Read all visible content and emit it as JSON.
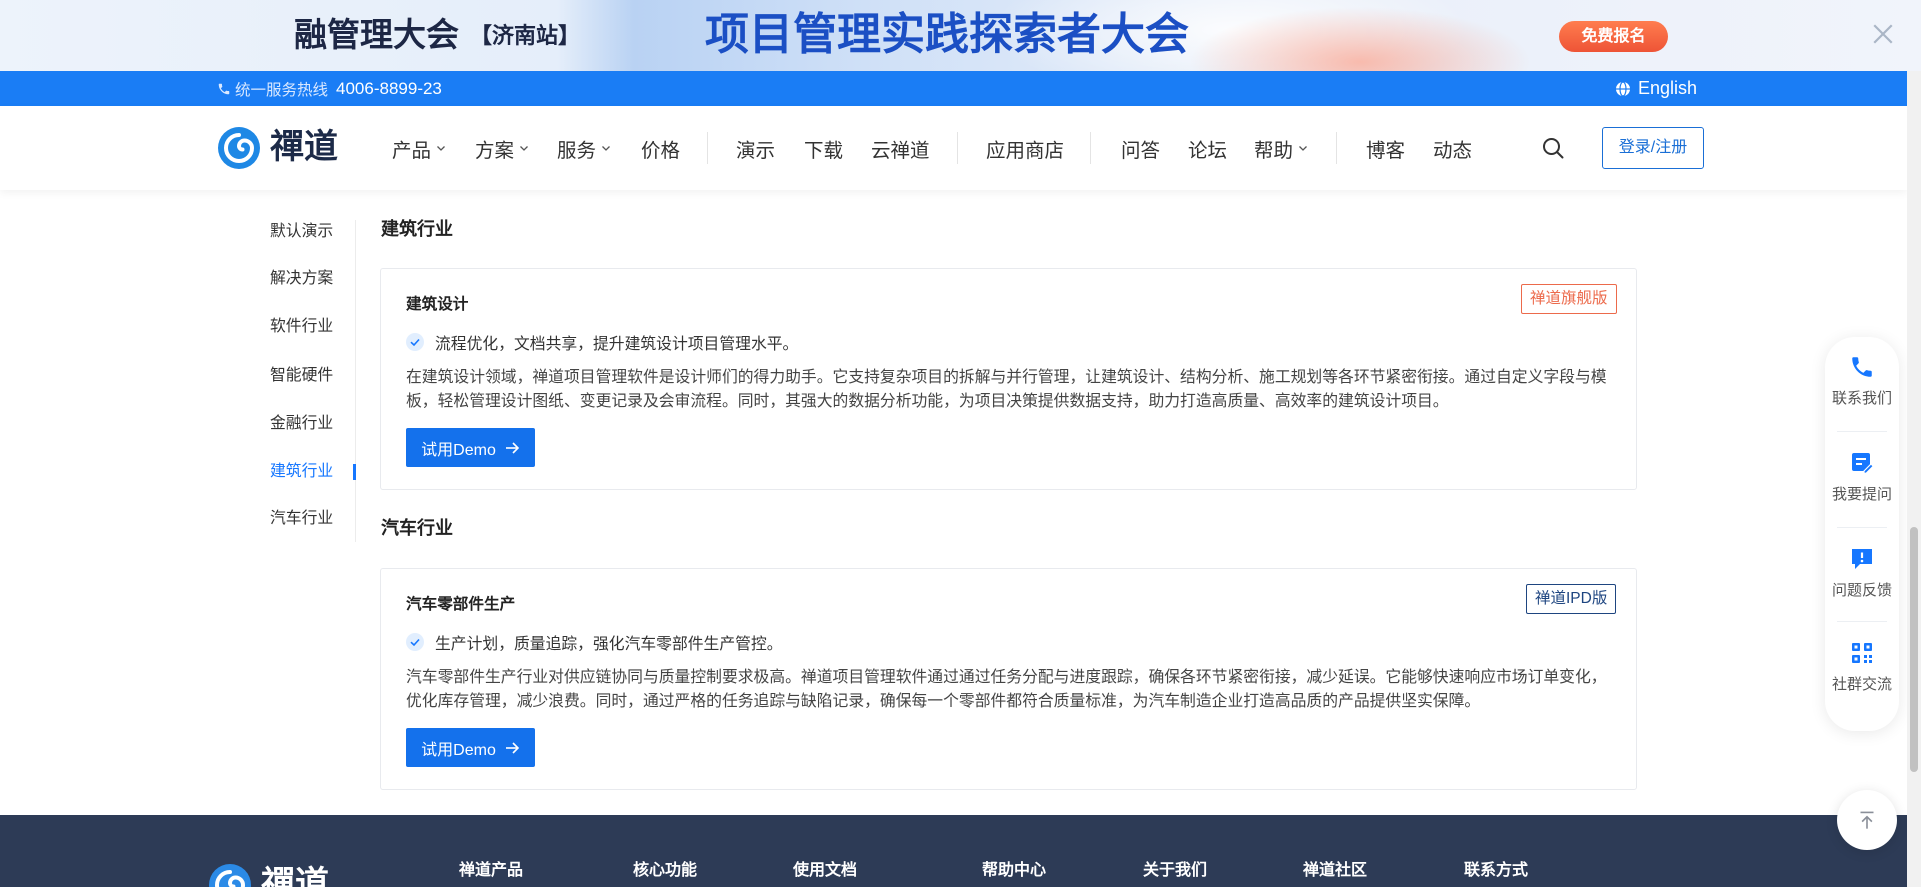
{
  "banner": {
    "event_prefix": "融管理大会",
    "event_city": "【济南站】",
    "headline": "项目管理实践探索者大会",
    "cta_label": "免费报名",
    "close_icon": "close-icon"
  },
  "topbar": {
    "hotline_icon": "phone-icon",
    "hotline_label": "统一服务热线",
    "hotline_number": "4006-8899-23",
    "language_icon": "globe-icon",
    "language_label": "English"
  },
  "header": {
    "logo_text": "禪道",
    "nav": [
      {
        "label": "产品",
        "dropdown": true
      },
      {
        "label": "方案",
        "dropdown": true
      },
      {
        "label": "服务",
        "dropdown": true
      },
      {
        "label": "价格",
        "dropdown": false
      },
      {
        "label": "演示",
        "dropdown": false
      },
      {
        "label": "下载",
        "dropdown": false
      },
      {
        "label": "云禅道",
        "dropdown": false
      },
      {
        "label": "应用商店",
        "dropdown": false
      },
      {
        "label": "问答",
        "dropdown": false
      },
      {
        "label": "论坛",
        "dropdown": false
      },
      {
        "label": "帮助",
        "dropdown": true
      },
      {
        "label": "博客",
        "dropdown": false
      },
      {
        "label": "动态",
        "dropdown": false
      }
    ],
    "search_icon": "search-icon",
    "login_label": "登录/注册"
  },
  "sidebar": {
    "items": [
      {
        "label": "默认演示",
        "active": false
      },
      {
        "label": "解决方案",
        "active": false
      },
      {
        "label": "软件行业",
        "active": false
      },
      {
        "label": "智能硬件",
        "active": false
      },
      {
        "label": "金融行业",
        "active": false
      },
      {
        "label": "建筑行业",
        "active": true
      },
      {
        "label": "汽车行业",
        "active": false
      }
    ]
  },
  "sections": [
    {
      "heading": "建筑行业",
      "card": {
        "title": "建筑设计",
        "badge": "禅道旗舰版",
        "badge_color": "#ec6a4b",
        "feature": "流程优化，文档共享，提升建筑设计项目管理水平。",
        "description": "在建筑设计领域，禅道项目管理软件是设计师们的得力助手。它支持复杂项目的拆解与并行管理，让建筑设计、结构分析、施工规划等各环节紧密衔接。通过自定义字段与模板，轻松管理设计图纸、变更记录及会审流程。同时，其强大的数据分析功能，为项目决策提供数据支持，助力打造高质量、高效率的建筑设计项目。",
        "button_label": "试用Demo"
      }
    },
    {
      "heading": "汽车行业",
      "card": {
        "title": "汽车零部件生产",
        "badge": "禅道IPD版",
        "badge_color": "#1e4580",
        "feature": "生产计划，质量追踪，强化汽车零部件生产管控。",
        "description": "汽车零部件生产行业对供应链协同与质量控制要求极高。禅道项目管理软件通过通过任务分配与进度跟踪，确保各环节紧密衔接，减少延误。它能够快速响应市场订单变化，优化库存管理，减少浪费。同时，通过严格的任务追踪与缺陷记录，确保每一个零部件都符合质量标准，为汽车制造企业打造高品质的产品提供坚实保障。",
        "button_label": "试用Demo"
      }
    }
  ],
  "float_panel": {
    "items": [
      {
        "label": "联系我们",
        "icon": "phone-icon"
      },
      {
        "label": "我要提问",
        "icon": "ask-question-icon"
      },
      {
        "label": "问题反馈",
        "icon": "feedback-icon"
      },
      {
        "label": "社群交流",
        "icon": "qr-code-icon"
      }
    ],
    "back_to_top_icon": "back-to-top-icon"
  },
  "footer": {
    "logo_text": "禪道",
    "columns": [
      "禅道产品",
      "核心功能",
      "使用文档",
      "帮助中心",
      "关于我们",
      "禅道社区",
      "联系方式"
    ]
  },
  "colors": {
    "primary": "#1677ff",
    "topbar": "#1a7df5",
    "footer": "#2d3b56"
  }
}
